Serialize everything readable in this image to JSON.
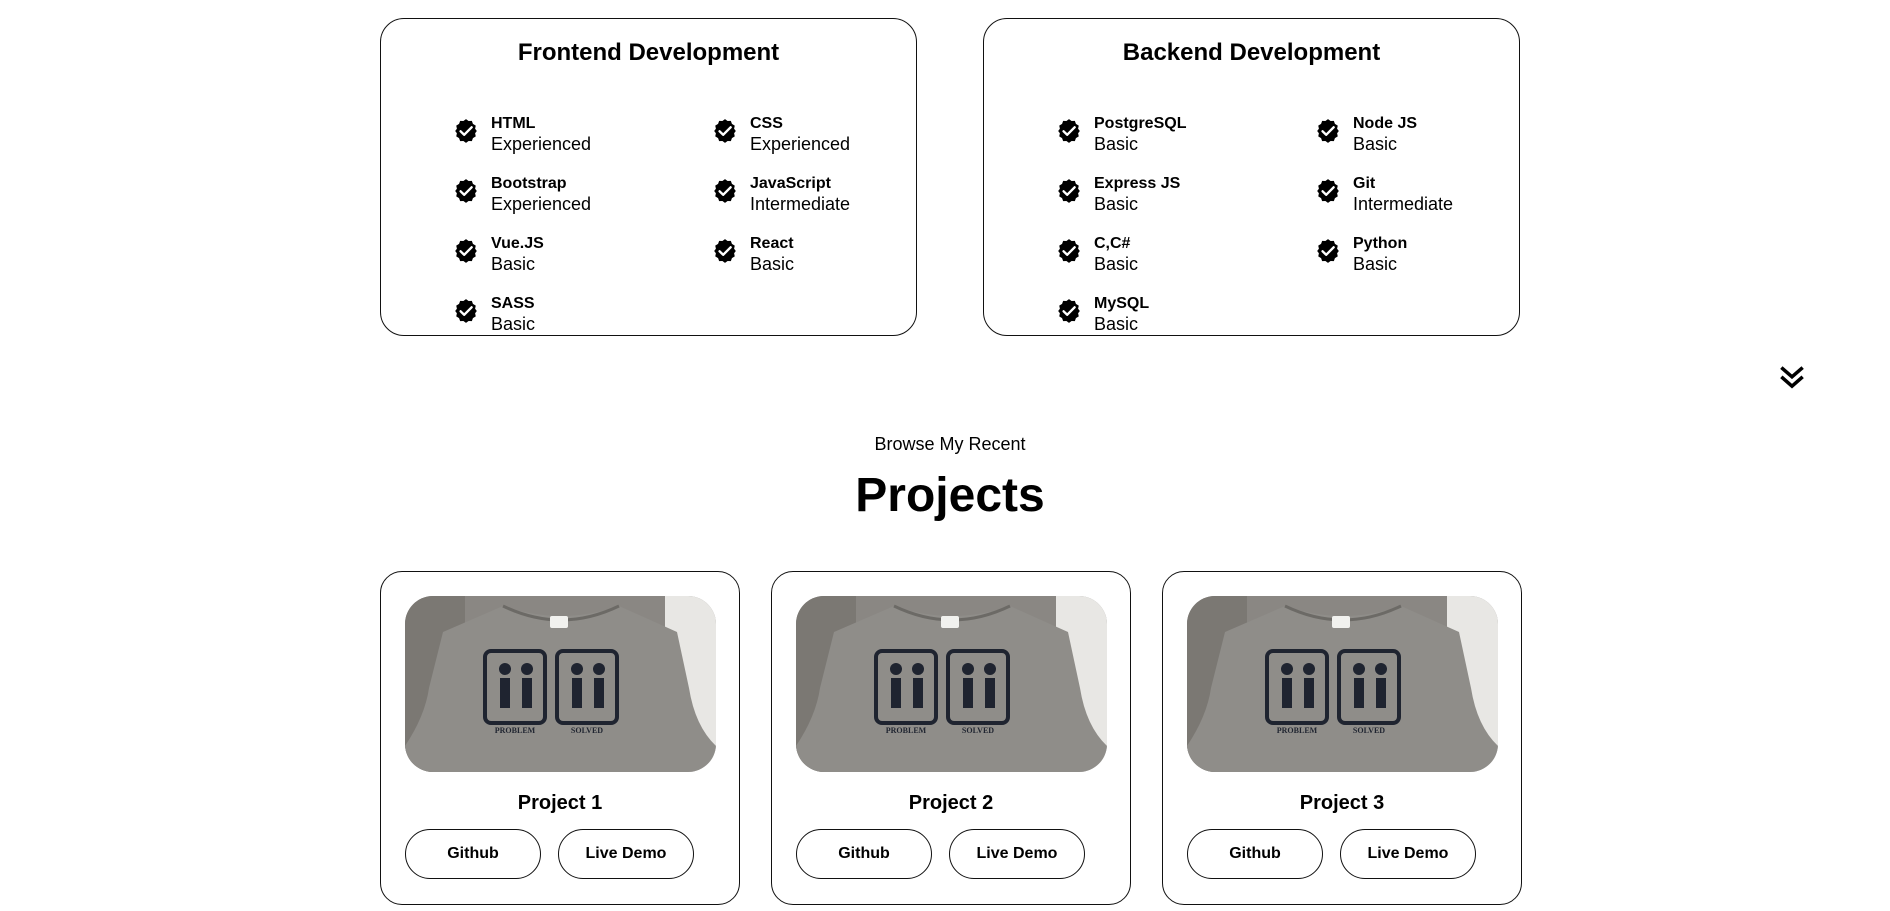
{
  "skills": {
    "frontend": {
      "title": "Frontend Development",
      "items": [
        {
          "name": "HTML",
          "level": "Experienced"
        },
        {
          "name": "CSS",
          "level": "Experienced"
        },
        {
          "name": "Bootstrap",
          "level": "Experienced"
        },
        {
          "name": "JavaScript",
          "level": "Intermediate"
        },
        {
          "name": "Vue.JS",
          "level": "Basic"
        },
        {
          "name": "React",
          "level": "Basic"
        },
        {
          "name": "SASS",
          "level": "Basic"
        }
      ]
    },
    "backend": {
      "title": "Backend Development",
      "items": [
        {
          "name": "PostgreSQL",
          "level": "Basic"
        },
        {
          "name": "Node JS",
          "level": "Basic"
        },
        {
          "name": "Express JS",
          "level": "Basic"
        },
        {
          "name": "Git",
          "level": "Intermediate"
        },
        {
          "name": "C,C#",
          "level": "Basic"
        },
        {
          "name": "Python",
          "level": "Basic"
        },
        {
          "name": "MySQL",
          "level": "Basic"
        }
      ]
    }
  },
  "projects_section": {
    "subtitle": "Browse My Recent",
    "title": "Projects",
    "items": [
      {
        "title": "Project 1",
        "github_label": "Github",
        "demo_label": "Live Demo",
        "shirt_text_left": "PROBLEM",
        "shirt_text_right": "SOLVED"
      },
      {
        "title": "Project 2",
        "github_label": "Github",
        "demo_label": "Live Demo",
        "shirt_text_left": "PROBLEM",
        "shirt_text_right": "SOLVED"
      },
      {
        "title": "Project 3",
        "github_label": "Github",
        "demo_label": "Live Demo",
        "shirt_text_left": "PROBLEM",
        "shirt_text_right": "SOLVED"
      }
    ]
  },
  "icons": {
    "check": "check-badge-icon",
    "scroll": "chevrons-down-icon"
  },
  "colors": {
    "text": "#000000",
    "border": "#111111",
    "background": "#ffffff",
    "shirt": "#8c8a86"
  }
}
